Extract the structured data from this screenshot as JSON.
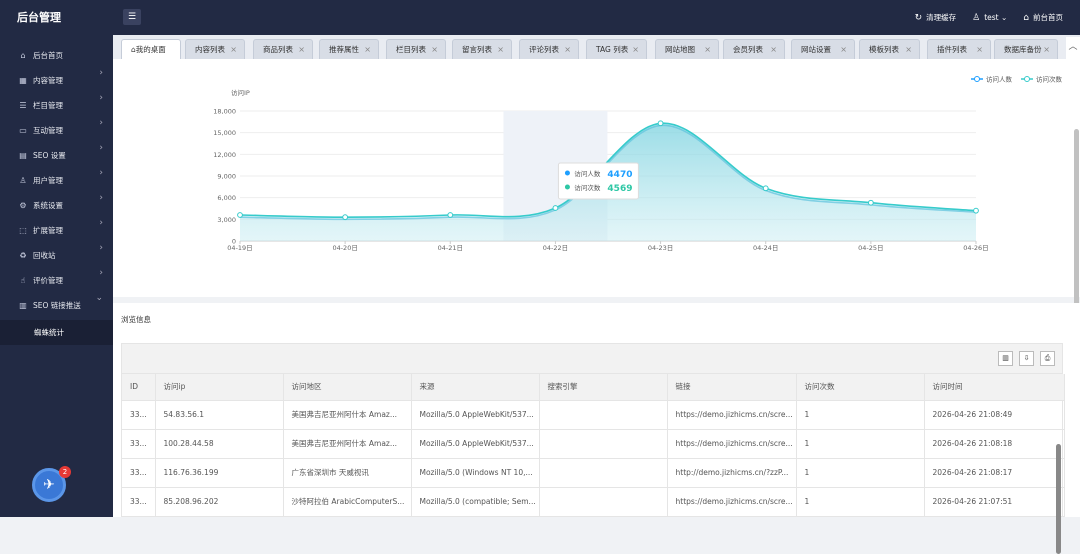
{
  "sidebar": {
    "logo": "后台管理",
    "items": [
      {
        "icon": "home-icon",
        "glyph": "⌂",
        "label": "后台首页",
        "arrow": false
      },
      {
        "icon": "grid-icon",
        "glyph": "▦",
        "label": "内容管理",
        "arrow": true
      },
      {
        "icon": "list-icon",
        "glyph": "☰",
        "label": "栏目管理",
        "arrow": true
      },
      {
        "icon": "card-icon",
        "glyph": "▭",
        "label": "互动管理",
        "arrow": true
      },
      {
        "icon": "seo-icon",
        "glyph": "▤",
        "label": "SEO 设置",
        "arrow": true
      },
      {
        "icon": "user-icon",
        "glyph": "♙",
        "label": "用户管理",
        "arrow": true
      },
      {
        "icon": "gear-icon",
        "glyph": "⚙",
        "label": "系统设置",
        "arrow": true
      },
      {
        "icon": "extend-icon",
        "glyph": "⬚",
        "label": "扩展管理",
        "arrow": true
      },
      {
        "icon": "trash-icon",
        "glyph": "♻",
        "label": "回收站",
        "arrow": true
      },
      {
        "icon": "thumb-icon",
        "glyph": "☝",
        "label": "评价管理",
        "arrow": true
      },
      {
        "icon": "bar-chart-icon",
        "glyph": "▥",
        "label": "SEO 链接推送",
        "arrow": true
      }
    ],
    "submenu": "蜘蛛统计",
    "badge": "2"
  },
  "topbar": {
    "menu_glyph": "☰",
    "clear_cache": "清理缓存",
    "user": "test",
    "front_home": "前台首页"
  },
  "tabs": [
    {
      "label": "我的桌面",
      "active": true
    },
    {
      "label": "内容列表"
    },
    {
      "label": "商品列表"
    },
    {
      "label": "推荐属性"
    },
    {
      "label": "栏目列表"
    },
    {
      "label": "留言列表"
    },
    {
      "label": "评论列表"
    },
    {
      "label": "TAG 列表"
    },
    {
      "label": "网站地图"
    },
    {
      "label": "会员列表"
    },
    {
      "label": "网站设置"
    },
    {
      "label": "模板列表"
    },
    {
      "label": "插件列表"
    },
    {
      "label": "数据库备份"
    }
  ],
  "chart_data": {
    "type": "area",
    "ylabel": "访问IP",
    "x": [
      "04-19日",
      "04-20日",
      "04-21日",
      "04-22日",
      "04-23日",
      "04-24日",
      "04-25日",
      "04-26日"
    ],
    "yticks": [
      "0",
      "3,000",
      "6,000",
      "9,000",
      "12,000",
      "15,000",
      "18,000"
    ],
    "ylim": [
      0,
      18000
    ],
    "series": [
      {
        "name": "访问人数",
        "values": [
          3300,
          3000,
          3300,
          4300,
          16000,
          7000,
          5000,
          4000
        ],
        "color": "#1e9fff"
      },
      {
        "name": "访问次数",
        "values": [
          3600,
          3300,
          3600,
          4569,
          16300,
          7300,
          5300,
          4200
        ],
        "color": "#36cbcb"
      }
    ],
    "tooltip": {
      "x_index": 3,
      "items": [
        {
          "label": "访问人数",
          "value": "4470",
          "color": "#1e9fff"
        },
        {
          "label": "访问次数",
          "value": "4569",
          "color": "#2ec7a5"
        }
      ]
    },
    "legend_position": "top-right",
    "grid": true
  },
  "info": {
    "title": "浏览信息",
    "columns": [
      "ID",
      "访问ip",
      "访问地区",
      "来源",
      "搜索引擎",
      "链接",
      "访问次数",
      "访问时间"
    ],
    "rows": [
      [
        "33...",
        "54.83.56.1",
        "美国弗吉尼亚州阿什本 Amaz...",
        "Mozilla/5.0 AppleWebKit/537...",
        "",
        "https://demo.jizhicms.cn/scre...",
        "1",
        "2026-04-26 21:08:49"
      ],
      [
        "33...",
        "100.28.44.58",
        "美国弗吉尼亚州阿什本 Amaz...",
        "Mozilla/5.0 AppleWebKit/537...",
        "",
        "https://demo.jizhicms.cn/scre...",
        "1",
        "2026-04-26 21:08:18"
      ],
      [
        "33...",
        "116.76.36.199",
        "广东省深圳市 天威视讯",
        "Mozilla/5.0 (Windows NT 10,...",
        "",
        "http://demo.jizhicms.cn/?zzP...",
        "1",
        "2026-04-26 21:08:17"
      ],
      [
        "33...",
        "85.208.96.202",
        "沙特阿拉伯 ArabicComputerS...",
        "Mozilla/5.0 (compatible; Sem...",
        "",
        "https://demo.jizhicms.cn/scre...",
        "1",
        "2026-04-26 21:07:51"
      ]
    ]
  }
}
